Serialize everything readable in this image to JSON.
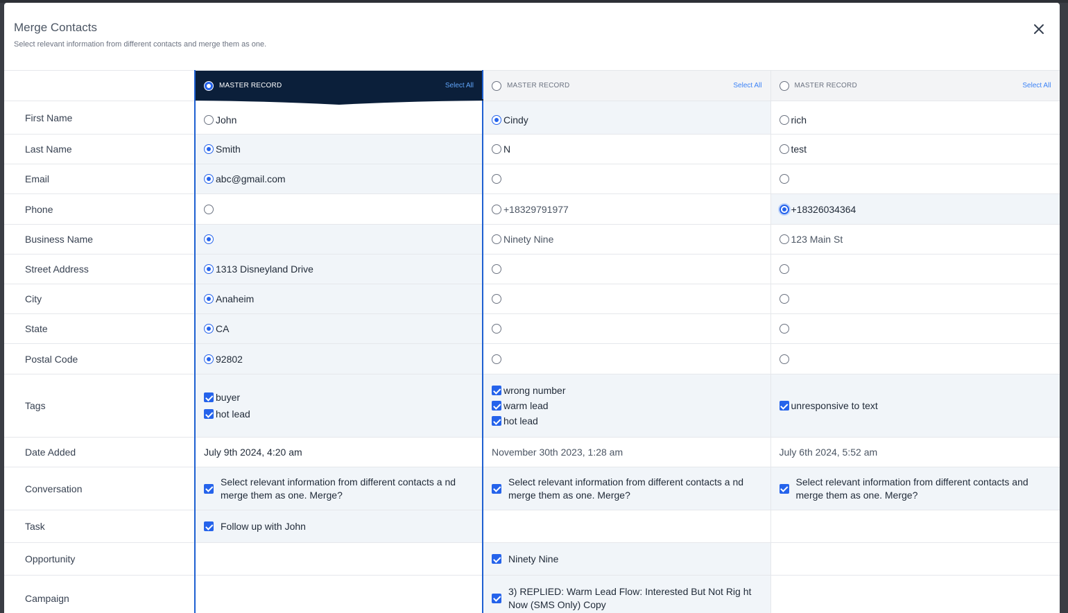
{
  "modal": {
    "title": "Merge Contacts",
    "subtitle": "Select relevant information from different contacts and merge them as one."
  },
  "headers": [
    {
      "label": "MASTER RECORD",
      "select_all": "Select All",
      "master": true
    },
    {
      "label": "MASTER RECORD",
      "select_all": "Select All",
      "master": false
    },
    {
      "label": "MASTER RECORD",
      "select_all": "Select All",
      "master": false
    }
  ],
  "rows": {
    "first_name": {
      "label": "First Name",
      "values": [
        "John",
        "Cindy",
        "rich"
      ],
      "selected": 1
    },
    "last_name": {
      "label": "Last Name",
      "values": [
        "Smith",
        "N",
        "test"
      ],
      "selected": 0
    },
    "email": {
      "label": "Email",
      "values": [
        "abc@gmail.com",
        "",
        ""
      ],
      "selected": 0
    },
    "phone": {
      "label": "Phone",
      "values": [
        "",
        "+18329791977",
        "+18326034364"
      ],
      "selected": 2
    },
    "business_name": {
      "label": "Business Name",
      "values": [
        "",
        "Ninety Nine",
        "123 Main St"
      ],
      "selected": 0
    },
    "street_address": {
      "label": "Street Address",
      "values": [
        "1313 Disneyland Drive",
        "",
        ""
      ],
      "selected": 0
    },
    "city": {
      "label": "City",
      "values": [
        "Anaheim",
        "",
        ""
      ],
      "selected": 0
    },
    "state": {
      "label": "State",
      "values": [
        "CA",
        "",
        ""
      ],
      "selected": 0
    },
    "postal_code": {
      "label": "Postal Code",
      "values": [
        "92802",
        "",
        ""
      ],
      "selected": 0
    },
    "tags": {
      "label": "Tags",
      "values": [
        [
          "buyer",
          "hot lead"
        ],
        [
          "wrong number",
          "warm lead",
          "hot lead"
        ],
        [
          "unresponsive to text"
        ]
      ]
    },
    "date_added": {
      "label": "Date Added",
      "values": [
        "July 9th 2024, 4:20 am",
        "November 30th 2023, 1:28 am",
        "July 6th 2024, 5:52 am"
      ]
    },
    "conversation": {
      "label": "Conversation",
      "values": [
        "Select relevant information from different contacts a nd merge them as one. Merge?",
        "Select relevant information from different contacts a nd merge them as one. Merge?",
        "Select relevant information from different contacts and merge them as one. Merge?"
      ]
    },
    "task": {
      "label": "Task",
      "values": [
        "Follow up with John",
        "",
        ""
      ]
    },
    "opportunity": {
      "label": "Opportunity",
      "values": [
        "",
        "Ninety Nine",
        ""
      ]
    },
    "campaign": {
      "label": "Campaign",
      "values": [
        "",
        "3) REPLIED: Warm Lead Flow: Interested But Not Rig ht Now (SMS Only) Copy",
        ""
      ]
    }
  },
  "colors": {
    "accent": "#2563eb",
    "master_header": "#0b1f3a",
    "selected_cell": "#f1f5f9"
  },
  "icons": {
    "close": "close-icon",
    "radio": "radio-icon",
    "checkbox": "checkbox-icon"
  }
}
